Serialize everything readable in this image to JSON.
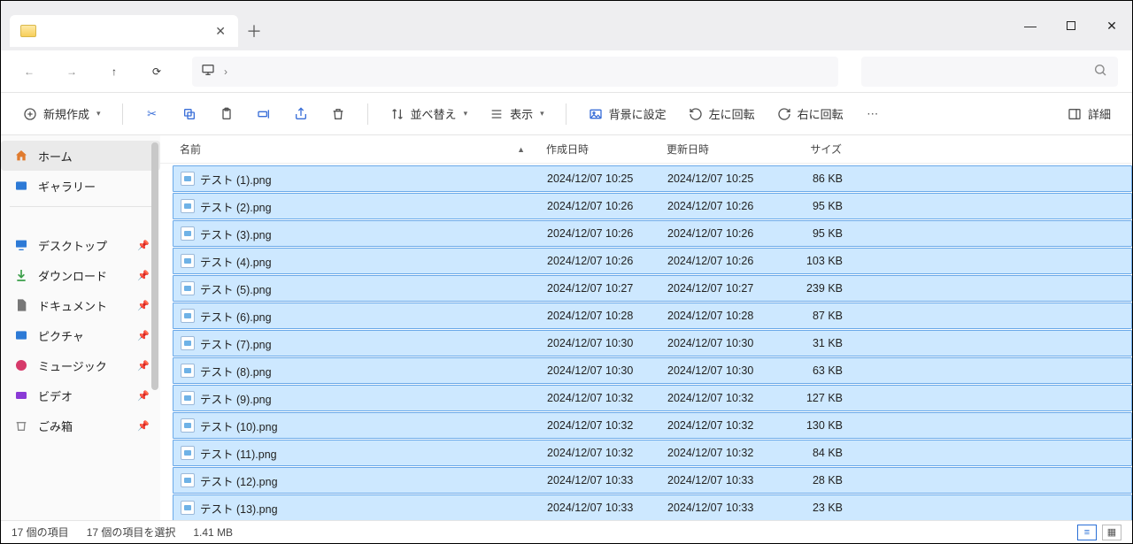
{
  "tab": {
    "title": ""
  },
  "toolbar": {
    "new": "新規作成",
    "sort": "並べ替え",
    "view": "表示",
    "set_bg": "背景に設定",
    "rotate_left": "左に回転",
    "rotate_right": "右に回転",
    "details": "詳細"
  },
  "sidebar": {
    "home": "ホーム",
    "gallery": "ギャラリー",
    "desktop": "デスクトップ",
    "downloads": "ダウンロード",
    "documents": "ドキュメント",
    "pictures": "ピクチャ",
    "music": "ミュージック",
    "videos": "ビデオ",
    "trash": "ごみ箱"
  },
  "columns": {
    "name": "名前",
    "created": "作成日時",
    "modified": "更新日時",
    "size": "サイズ"
  },
  "files": [
    {
      "name": "テスト (1).png",
      "created": "2024/12/07 10:25",
      "modified": "2024/12/07 10:25",
      "size": "86 KB"
    },
    {
      "name": "テスト (2).png",
      "created": "2024/12/07 10:26",
      "modified": "2024/12/07 10:26",
      "size": "95 KB"
    },
    {
      "name": "テスト (3).png",
      "created": "2024/12/07 10:26",
      "modified": "2024/12/07 10:26",
      "size": "95 KB"
    },
    {
      "name": "テスト (4).png",
      "created": "2024/12/07 10:26",
      "modified": "2024/12/07 10:26",
      "size": "103 KB"
    },
    {
      "name": "テスト (5).png",
      "created": "2024/12/07 10:27",
      "modified": "2024/12/07 10:27",
      "size": "239 KB"
    },
    {
      "name": "テスト (6).png",
      "created": "2024/12/07 10:28",
      "modified": "2024/12/07 10:28",
      "size": "87 KB"
    },
    {
      "name": "テスト (7).png",
      "created": "2024/12/07 10:30",
      "modified": "2024/12/07 10:30",
      "size": "31 KB"
    },
    {
      "name": "テスト (8).png",
      "created": "2024/12/07 10:30",
      "modified": "2024/12/07 10:30",
      "size": "63 KB"
    },
    {
      "name": "テスト (9).png",
      "created": "2024/12/07 10:32",
      "modified": "2024/12/07 10:32",
      "size": "127 KB"
    },
    {
      "name": "テスト (10).png",
      "created": "2024/12/07 10:32",
      "modified": "2024/12/07 10:32",
      "size": "130 KB"
    },
    {
      "name": "テスト (11).png",
      "created": "2024/12/07 10:32",
      "modified": "2024/12/07 10:32",
      "size": "84 KB"
    },
    {
      "name": "テスト (12).png",
      "created": "2024/12/07 10:33",
      "modified": "2024/12/07 10:33",
      "size": "28 KB"
    },
    {
      "name": "テスト (13).png",
      "created": "2024/12/07 10:33",
      "modified": "2024/12/07 10:33",
      "size": "23 KB"
    }
  ],
  "status": {
    "count": "17 個の項目",
    "selected": "17 個の項目を選択",
    "size": "1.41 MB"
  }
}
